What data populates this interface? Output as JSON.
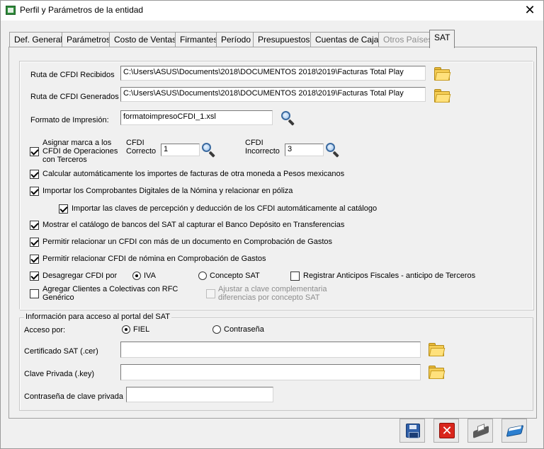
{
  "window": {
    "title": "Perfil y Parámetros de la entidad",
    "close_glyph": "✕"
  },
  "tabs": [
    {
      "label": "Def. General",
      "state": "normal"
    },
    {
      "label": "Parámetros",
      "state": "normal"
    },
    {
      "label": "Costo de Ventas",
      "state": "normal"
    },
    {
      "label": "Firmantes",
      "state": "normal"
    },
    {
      "label": "Período",
      "state": "normal"
    },
    {
      "label": "Presupuestos",
      "state": "normal"
    },
    {
      "label": "Cuentas de Cajas",
      "state": "normal"
    },
    {
      "label": "Otros Países",
      "state": "disabled"
    },
    {
      "label": "SAT",
      "state": "active"
    }
  ],
  "cfdi": {
    "recibidos_label": "Ruta de CFDI Recibidos",
    "recibidos_value": "C:\\Users\\ASUS\\Documents\\2018\\DOCUMENTOS 2018\\2019\\Facturas Total Play",
    "generados_label": "Ruta de CFDI Generados",
    "generados_value": "C:\\Users\\ASUS\\Documents\\2018\\DOCUMENTOS 2018\\2019\\Facturas Total Play",
    "formato_label": "Formato de Impresión:",
    "formato_value": "formatoimpresoCFDI_1.xsl"
  },
  "options": {
    "asignar_marca": {
      "label": "Asignar marca a los CFDI de Operaciones con Terceros",
      "checked": true
    },
    "cfdi_correcto_label": "CFDI Correcto",
    "cfdi_correcto_value": "1",
    "cfdi_incorrecto_label": "CFDI Incorrecto",
    "cfdi_incorrecto_value": "3",
    "calcular": {
      "label": "Calcular automáticamente los importes de facturas de otra moneda a Pesos mexicanos",
      "checked": true
    },
    "importar_nomina": {
      "label": "Importar los Comprobantes Digitales de la Nómina y relacionar en póliza",
      "checked": true
    },
    "importar_claves": {
      "label": "Importar las claves de percepción y deducción de los CFDI automáticamente al catálogo",
      "checked": true
    },
    "mostrar_bancos": {
      "label": "Mostrar el catálogo de bancos del SAT al capturar el Banco Depósito en Transferencias",
      "checked": true
    },
    "permitir_varios": {
      "label": "Permitir relacionar un CFDI con más de un documento en Comprobación de Gastos",
      "checked": true
    },
    "permitir_nomina": {
      "label": "Permitir relacionar CFDI de nómina en Comprobación de Gastos",
      "checked": true
    },
    "desagregar": {
      "label": "Desagregar CFDI por",
      "checked": true
    },
    "radio_iva": {
      "label": "IVA",
      "selected": true
    },
    "radio_concepto": {
      "label": "Concepto SAT",
      "selected": false
    },
    "registrar_anticipos": {
      "label": "Registrar Anticipos Fiscales - anticipo de Terceros",
      "checked": false
    },
    "agregar_clientes": {
      "label": "Agregar Clientes a Colectivas con RFC Genérico",
      "checked": false
    },
    "ajustar_clave": {
      "label": "Ajustar a clave complementaria diferencias por concepto SAT",
      "checked": false,
      "disabled": true
    }
  },
  "portal": {
    "legend": "Información para acceso al portal del SAT",
    "acceso_label": "Acceso por:",
    "radio_fiel": {
      "label": "FIEL",
      "selected": true
    },
    "radio_contrasena": {
      "label": "Contraseña",
      "selected": false
    },
    "certificado_label": "Certificado SAT (.cer)",
    "certificado_value": "",
    "clave_label": "Clave Privada (.key)",
    "clave_value": "",
    "contrasena_label": "Contraseña de clave privada",
    "contrasena_value": ""
  },
  "footer_buttons": [
    {
      "icon": "save-icon"
    },
    {
      "icon": "cancel-icon"
    },
    {
      "icon": "print-icon"
    },
    {
      "icon": "help-book-icon"
    }
  ],
  "colors": {
    "window_bg": "#f0f0f0",
    "cancel_red": "#d9261c",
    "save_blue": "#2f5fa8",
    "folder_yellow": "#f5cd55"
  }
}
